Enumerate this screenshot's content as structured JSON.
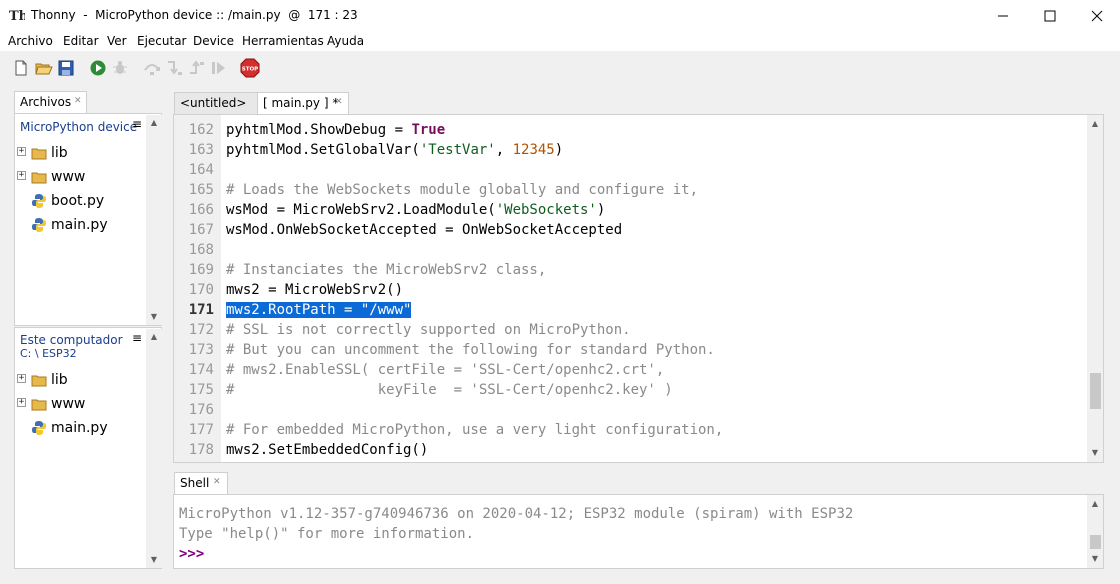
{
  "window": {
    "app_name": "Thonny",
    "title": "Thonny  -  MicroPython device :: /main.py  @  171 : 23"
  },
  "menu": [
    "Archivo",
    "Editar",
    "Ver",
    "Ejecutar",
    "Device",
    "Herramientas",
    "Ayuda"
  ],
  "toolbar": {
    "icons": [
      "new-file-icon",
      "open-file-icon",
      "save-file-icon",
      "run-icon",
      "debug-icon",
      "step-over-icon",
      "step-into-icon",
      "step-out-icon",
      "resume-icon",
      "stop-icon"
    ],
    "stop_label": "STOP"
  },
  "files_panel": {
    "tab_label": "Archivos",
    "device_header": "MicroPython device",
    "device_items": [
      {
        "name": "lib",
        "type": "folder"
      },
      {
        "name": "www",
        "type": "folder"
      },
      {
        "name": "boot.py",
        "type": "python-file"
      },
      {
        "name": "main.py",
        "type": "python-file"
      }
    ],
    "computer_header": "Este computador",
    "computer_path": "C: \\ ESP32",
    "computer_items": [
      {
        "name": "lib",
        "type": "folder"
      },
      {
        "name": "www",
        "type": "folder"
      },
      {
        "name": "main.py",
        "type": "python-file"
      }
    ],
    "menu_icon": "≡"
  },
  "editor": {
    "tabs": [
      {
        "label": "<untitled>",
        "active": false
      },
      {
        "label": "[ main.py ] *",
        "active": true
      }
    ],
    "current_line": 171,
    "lines": [
      {
        "n": "162",
        "text": "pyhtmlMod.ShowDebug = True"
      },
      {
        "n": "163",
        "text": "pyhtmlMod.SetGlobalVar('TestVar', 12345)"
      },
      {
        "n": "164",
        "text": ""
      },
      {
        "n": "165",
        "text": "# Loads the WebSockets module globally and configure it,"
      },
      {
        "n": "166",
        "text": "wsMod = MicroWebSrv2.LoadModule('WebSockets')"
      },
      {
        "n": "167",
        "text": "wsMod.OnWebSocketAccepted = OnWebSocketAccepted"
      },
      {
        "n": "168",
        "text": ""
      },
      {
        "n": "169",
        "text": "# Instanciates the MicroWebSrv2 class,"
      },
      {
        "n": "170",
        "text": "mws2 = MicroWebSrv2()"
      },
      {
        "n": "171",
        "text": "mws2.RootPath = \"/www\""
      },
      {
        "n": "172",
        "text": "# SSL is not correctly supported on MicroPython."
      },
      {
        "n": "173",
        "text": "# But you can uncomment the following for standard Python."
      },
      {
        "n": "174",
        "text": "# mws2.EnableSSL( certFile = 'SSL-Cert/openhc2.crt',"
      },
      {
        "n": "175",
        "text": "#                 keyFile  = 'SSL-Cert/openhc2.key' )"
      },
      {
        "n": "176",
        "text": ""
      },
      {
        "n": "177",
        "text": "# For embedded MicroPython, use a very light configuration,"
      },
      {
        "n": "178",
        "text": "mws2.SetEmbeddedConfig()"
      }
    ]
  },
  "shell": {
    "tab_label": "Shell",
    "lines": [
      "MicroPython v1.12-357-g740946736 on 2020-04-12; ESP32 module (spiram) with ESP32",
      "Type \"help()\" for more information."
    ],
    "prompt": ">>>"
  },
  "colors": {
    "selection": "#0b6ad6",
    "keyword": "#7a0c5a",
    "string": "#0e5d1f",
    "number": "#b05300",
    "comment": "#8a8a8a",
    "stop": "#d32f2f",
    "run": "#2e8b3a"
  }
}
